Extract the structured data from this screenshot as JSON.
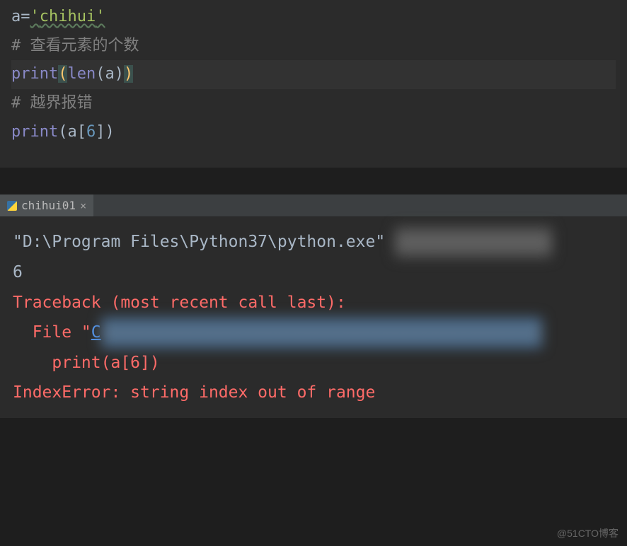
{
  "code": {
    "line1": {
      "var": "a",
      "eq": "=",
      "q1": "'",
      "str": "chihui",
      "q2": "'"
    },
    "line2": "# 查看元素的个数",
    "line3": {
      "fn1": "print",
      "p1": "(",
      "fn2": "len",
      "p2": "(",
      "arg": "a",
      "p3": ")",
      "p4": ")"
    },
    "line4": "# 越界报错",
    "line5": {
      "fn": "print",
      "p1": "(",
      "arg": "a",
      "b1": "[",
      "num": "6",
      "b2": "]",
      "p2": ")"
    }
  },
  "tab": {
    "name": "chihui01",
    "close": "×"
  },
  "console": {
    "exec": "\"D:\\Program Files\\Python37\\python.exe\" ",
    "output": "6",
    "traceback": "Traceback (most recent call last):",
    "file_prefix": "  File \"",
    "file_link": "C",
    "print_line": "    print(a[6])",
    "error": "IndexError: string index out of range"
  },
  "watermark": "@51CTO博客"
}
